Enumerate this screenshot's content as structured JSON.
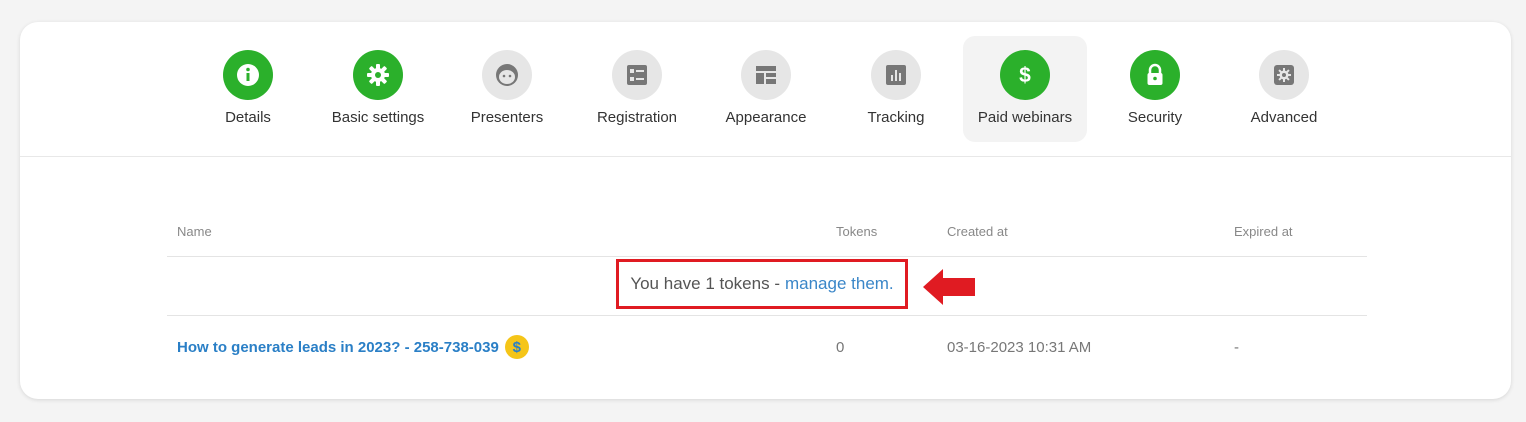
{
  "tabs": [
    {
      "label": "Details",
      "icon": "info-icon",
      "color": "green"
    },
    {
      "label": "Basic settings",
      "icon": "gear-icon",
      "color": "green"
    },
    {
      "label": "Presenters",
      "icon": "person-face-icon",
      "color": "grey"
    },
    {
      "label": "Registration",
      "icon": "form-icon",
      "color": "grey"
    },
    {
      "label": "Appearance",
      "icon": "layout-icon",
      "color": "grey"
    },
    {
      "label": "Tracking",
      "icon": "bar-chart-icon",
      "color": "grey"
    },
    {
      "label": "Paid webinars",
      "icon": "dollar-icon",
      "color": "green",
      "active": true
    },
    {
      "label": "Security",
      "icon": "lock-icon",
      "color": "green"
    },
    {
      "label": "Advanced",
      "icon": "gear-icon",
      "color": "grey"
    }
  ],
  "table": {
    "headers": {
      "name": "Name",
      "tokens": "Tokens",
      "created": "Created at",
      "expired": "Expired at"
    },
    "notice": {
      "text": "You have 1 tokens -",
      "link": "manage them."
    },
    "rows": [
      {
        "name": "How to generate leads in 2023? - 258-738-039",
        "coin": "$",
        "tokens": "0",
        "created": "03-16-2023 10:31 AM",
        "expired": "-"
      }
    ]
  },
  "colors": {
    "green": "#2bb02b",
    "grey": "#e6e6e6",
    "accent": "#2a7fc6",
    "highlight": "#e01b22"
  }
}
